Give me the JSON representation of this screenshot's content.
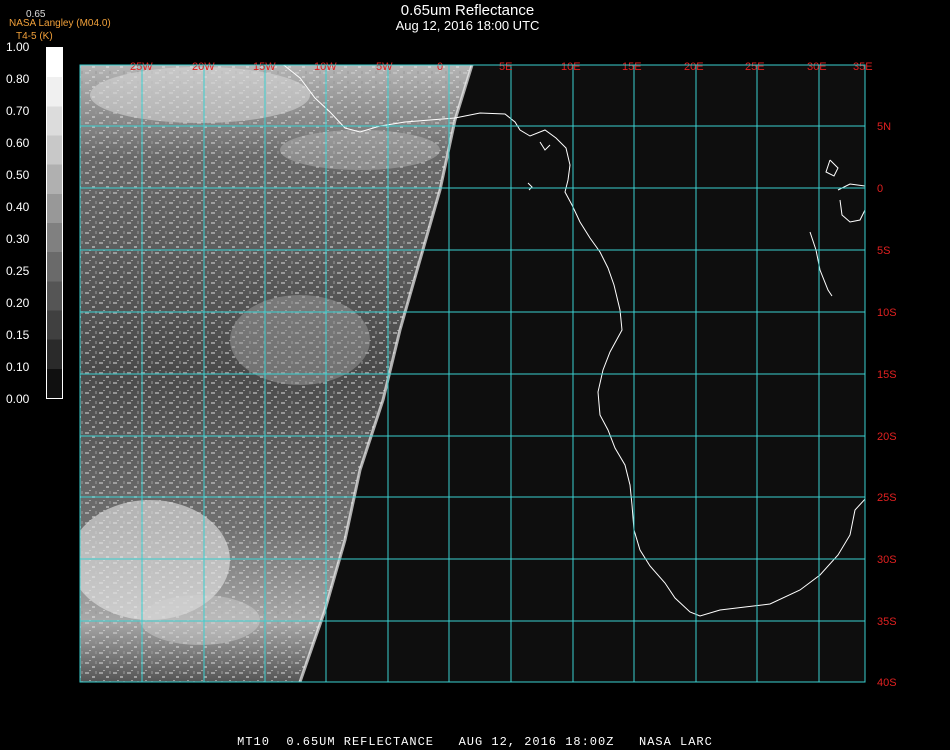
{
  "header": {
    "title": "0.65um Reflectance",
    "timestamp": "Aug 12, 2016 18:00 UTC"
  },
  "producer": {
    "org": "NASA Langley (M04.0)",
    "subtitle": "T4-5 (K)",
    "top_label": "0.65"
  },
  "colorbar": {
    "ticks": [
      "1.00",
      "0.80",
      "0.70",
      "0.60",
      "0.50",
      "0.40",
      "0.30",
      "0.25",
      "0.20",
      "0.15",
      "0.10",
      "0.00"
    ]
  },
  "grid": {
    "lon_labels": [
      "25W",
      "20W",
      "15W",
      "10W",
      "5W",
      "0",
      "5E",
      "10E",
      "15E",
      "20E",
      "25E",
      "30E",
      "35E"
    ],
    "lat_labels": [
      "5N",
      "0",
      "5S",
      "10S",
      "15S",
      "20S",
      "25S",
      "30S",
      "35S",
      "40S"
    ],
    "line_color": "#3ad0d0",
    "label_color": "#e02020"
  },
  "footer": {
    "text": "MT10  0.65UM REFLECTANCE   AUG 12, 2016 18:00Z   NASA LARC"
  }
}
